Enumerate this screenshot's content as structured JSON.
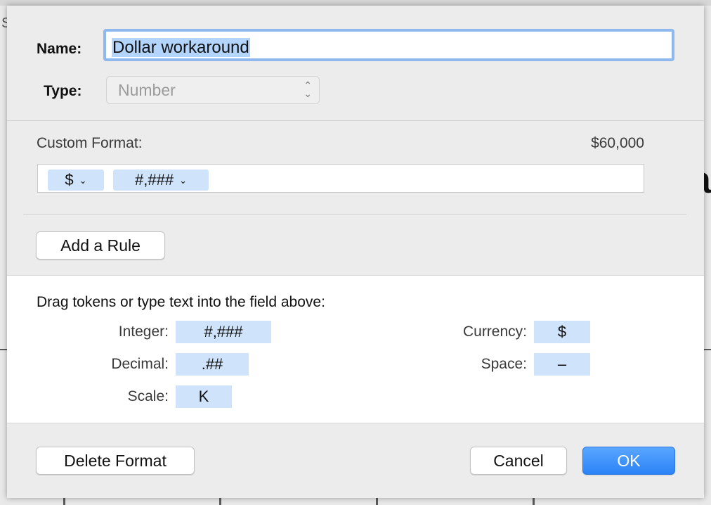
{
  "background": {
    "letter_fragment": "a",
    "corner_text": "S"
  },
  "dialog": {
    "name_label": "Name:",
    "name_value": "Dollar workaround",
    "type_label": "Type:",
    "type_value": "Number",
    "custom_format_label": "Custom Format:",
    "preview_value": "$60,000",
    "format_tokens": [
      {
        "label": "$",
        "icon": "chevron-down-icon"
      },
      {
        "label": "#,###",
        "icon": "chevron-down-icon"
      }
    ],
    "add_rule_label": "Add a Rule",
    "hint_text": "Drag tokens or type text into the field above:",
    "palette": {
      "integer": {
        "label": "Integer:",
        "token": "#,###"
      },
      "decimal": {
        "label": "Decimal:",
        "token": ".##"
      },
      "scale": {
        "label": "Scale:",
        "token": "K"
      },
      "currency": {
        "label": "Currency:",
        "token": "$"
      },
      "space": {
        "label": "Space:",
        "token": "–"
      }
    },
    "delete_label": "Delete Format",
    "cancel_label": "Cancel",
    "ok_label": "OK"
  },
  "colors": {
    "accent": "#2b83f6",
    "token_bg": "#cfe3fb",
    "selection": "#b3d4fd"
  }
}
